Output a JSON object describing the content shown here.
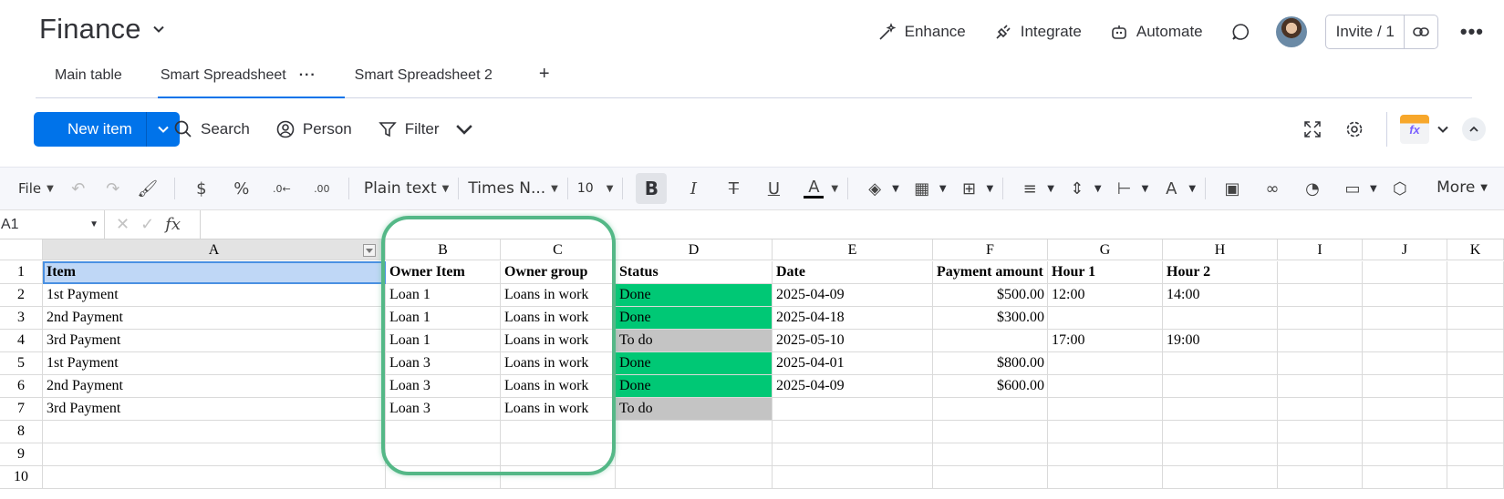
{
  "header": {
    "board_title": "Finance",
    "actions": [
      {
        "label": "Enhance",
        "icon": "magic-wand-icon"
      },
      {
        "label": "Integrate",
        "icon": "plug-icon"
      },
      {
        "label": "Automate",
        "icon": "robot-icon"
      }
    ],
    "invite_label": "Invite / 1"
  },
  "tabs": [
    {
      "label": "Main table",
      "active": false
    },
    {
      "label": "Smart Spreadsheet",
      "active": true
    },
    {
      "label": "Smart Spreadsheet 2",
      "active": false
    }
  ],
  "board_toolbar": {
    "new_item_label": "New item",
    "search_label": "Search",
    "person_label": "Person",
    "filter_label": "Filter"
  },
  "sheet_toolbar": {
    "file_label": "File",
    "number_format": "Plain text",
    "font_name": "Times N...",
    "font_size": "10",
    "more_label": "More"
  },
  "formula_bar": {
    "cell_ref": "A1",
    "fx_label": "fx"
  },
  "sheet": {
    "columns": [
      "A",
      "B",
      "C",
      "D",
      "E",
      "F",
      "G",
      "H",
      "I",
      "J",
      "K"
    ],
    "row_numbers": [
      "1",
      "2",
      "3",
      "4",
      "5",
      "6",
      "7",
      "8",
      "9",
      "10"
    ],
    "header_row": [
      "Item",
      "Owner Item",
      "Owner group",
      "Status",
      "Date",
      "Payment amount",
      "Hour 1",
      "Hour 2"
    ],
    "rows": [
      [
        "1st Payment",
        "Loan 1",
        "Loans in work",
        "Done",
        "2025-04-09",
        "$500.00",
        "12:00",
        "14:00"
      ],
      [
        "2nd Payment",
        "Loan 1",
        "Loans in work",
        "Done",
        "2025-04-18",
        "$300.00",
        "",
        ""
      ],
      [
        "3rd Payment",
        "Loan 1",
        "Loans in work",
        "To do",
        "2025-05-10",
        "",
        "17:00",
        "19:00"
      ],
      [
        "1st Payment",
        "Loan 3",
        "Loans in work",
        "Done",
        "2025-04-01",
        "$800.00",
        "",
        ""
      ],
      [
        "2nd Payment",
        "Loan 3",
        "Loans in work",
        "Done",
        "2025-04-09",
        "$600.00",
        "",
        ""
      ],
      [
        "3rd Payment",
        "Loan 3",
        "Loans in work",
        "To do",
        "",
        "",
        "",
        ""
      ]
    ],
    "status_colors": {
      "Done": "#00c875",
      "To do": "#c4c4c4"
    }
  },
  "colors": {
    "accent": "#0073ea",
    "highlight_outline": "#54b887",
    "selected_cell": "#bfd7f6"
  }
}
